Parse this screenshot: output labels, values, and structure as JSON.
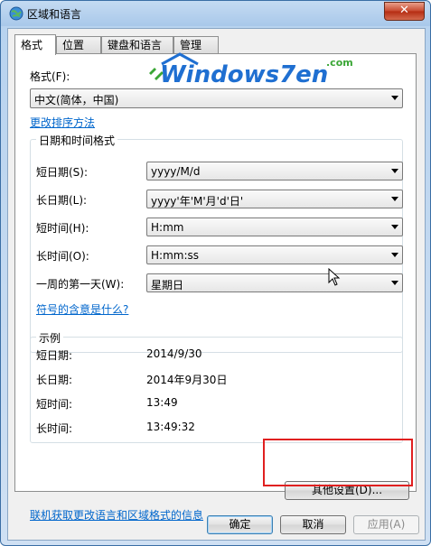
{
  "window": {
    "title": "区域和语言",
    "close_glyph": "✕"
  },
  "tabs": [
    {
      "label": "格式",
      "active": true
    },
    {
      "label": "位置",
      "active": false
    },
    {
      "label": "键盘和语言",
      "active": false
    },
    {
      "label": "管理",
      "active": false
    }
  ],
  "format": {
    "label": "格式(F):",
    "value": "中文(简体，中国)",
    "sort_link": "更改排序方法"
  },
  "logo": {
    "text": "Windows7en",
    "com": ".com"
  },
  "datetime_group": {
    "title": "日期和时间格式",
    "rows": [
      {
        "label": "短日期(S):",
        "value": "yyyy/M/d"
      },
      {
        "label": "长日期(L):",
        "value": "yyyy'年'M'月'd'日'"
      },
      {
        "label": "短时间(H):",
        "value": "H:mm"
      },
      {
        "label": "长时间(O):",
        "value": "H:mm:ss"
      },
      {
        "label": "一周的第一天(W):",
        "value": "星期日"
      }
    ],
    "help_link": "符号的含意是什么?"
  },
  "example_group": {
    "title": "示例",
    "rows": [
      {
        "label": "短日期:",
        "value": "2014/9/30"
      },
      {
        "label": "长日期:",
        "value": "2014年9月30日"
      },
      {
        "label": "短时间:",
        "value": "13:49"
      },
      {
        "label": "长时间:",
        "value": "13:49:32"
      }
    ]
  },
  "other_settings_button": "其他设置(D)...",
  "online_link": "联机获取更改语言和区域格式的信息",
  "buttons": {
    "ok": "确定",
    "cancel": "取消",
    "apply": "应用(A)"
  },
  "colors": {
    "link": "#0066cc",
    "highlight": "#e02020",
    "logo_blue": "#1f6fd1",
    "logo_green": "#3aa635"
  }
}
